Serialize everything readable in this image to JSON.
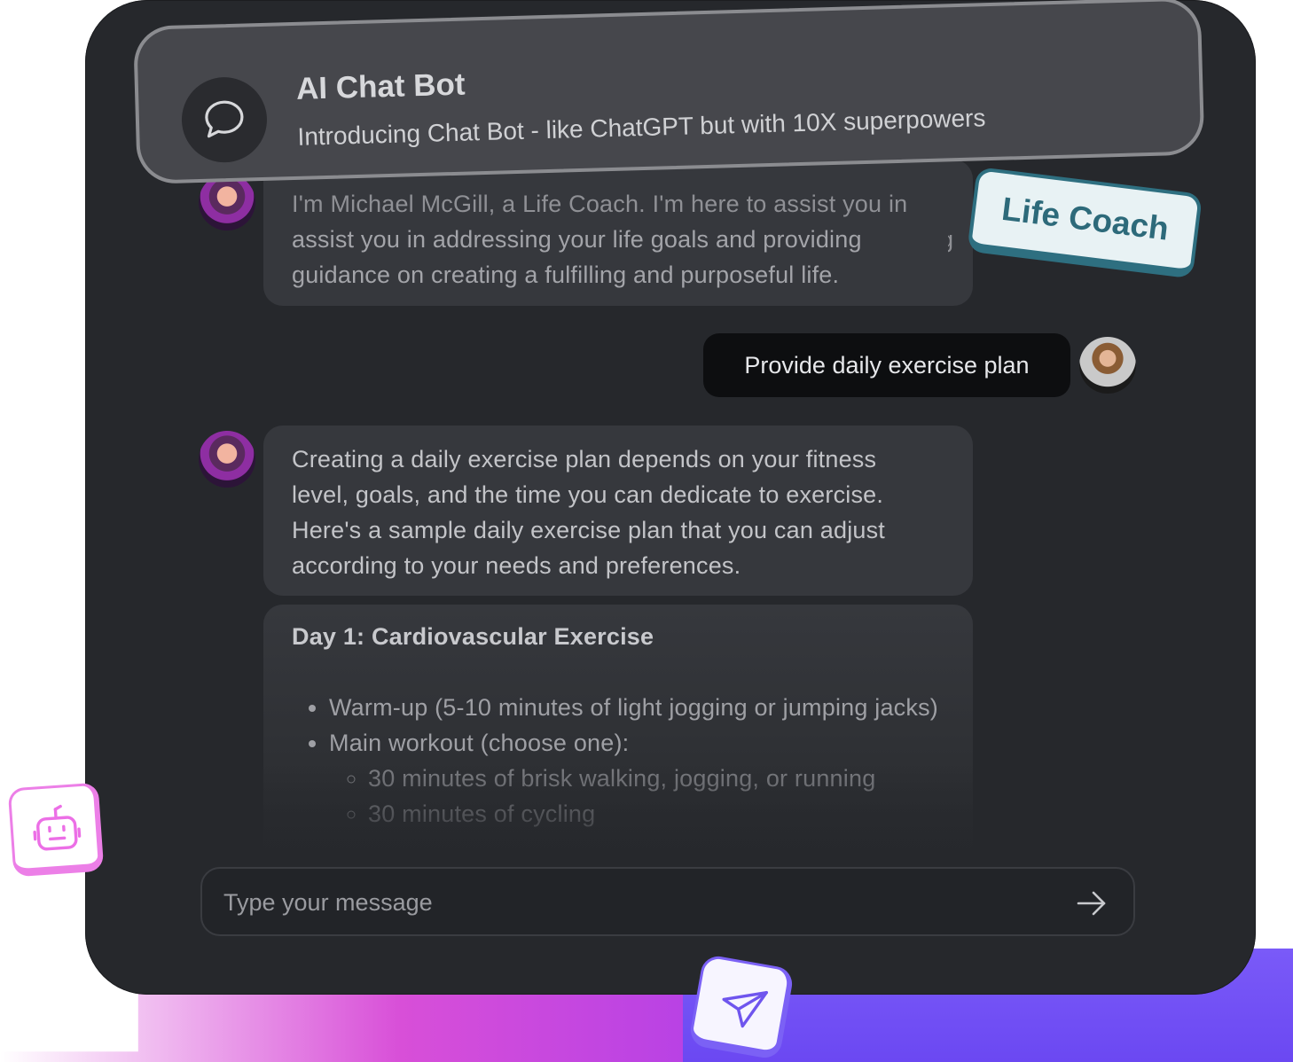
{
  "header": {
    "title": "AI Chat Bot",
    "subtitle": "Introducing Chat Bot - like ChatGPT but with 10X superpowers",
    "icon": "chat-bubble-icon"
  },
  "tag": {
    "label": "Life Coach"
  },
  "messages": {
    "intro_partial": "I'm Michael McGill, a Life Coach. I'm here to assist you in addressing your life goals and providing guidance on creating a fulfilling and purposeful life.",
    "intro_line2": "assist you in addressing your life goals and providing",
    "intro_line3": "guidance on creating a fulfilling and purposeful life.",
    "user_prompt": "Provide daily exercise plan",
    "answer_line1": "Creating a daily exercise plan depends on your fitness",
    "answer_line2": "level, goals, and the time you can dedicate to exercise.",
    "answer_line3": "Here's a sample daily exercise plan that you can adjust",
    "answer_line4": "according to your needs and preferences.",
    "plan": {
      "title": "Day 1: Cardiovascular Exercise",
      "items": [
        "Warm-up (5-10 minutes of light jogging or jumping jacks)",
        "Main workout (choose one):"
      ],
      "sub_items": [
        "30 minutes of brisk walking, jogging, or running",
        "30 minutes of cycling"
      ]
    }
  },
  "composer": {
    "placeholder": "Type your message",
    "send_icon": "arrow-right-icon"
  },
  "decor": {
    "bot_tile_icon": "robot-icon",
    "send_tile_icon": "paper-plane-icon"
  },
  "colors": {
    "panel_bg": "#26282c",
    "bubble_bg": "#36383d",
    "tag_accent": "#2e6f80",
    "bot_tile_accent": "#ec7fe7",
    "send_tile_accent": "#7b61f5"
  }
}
